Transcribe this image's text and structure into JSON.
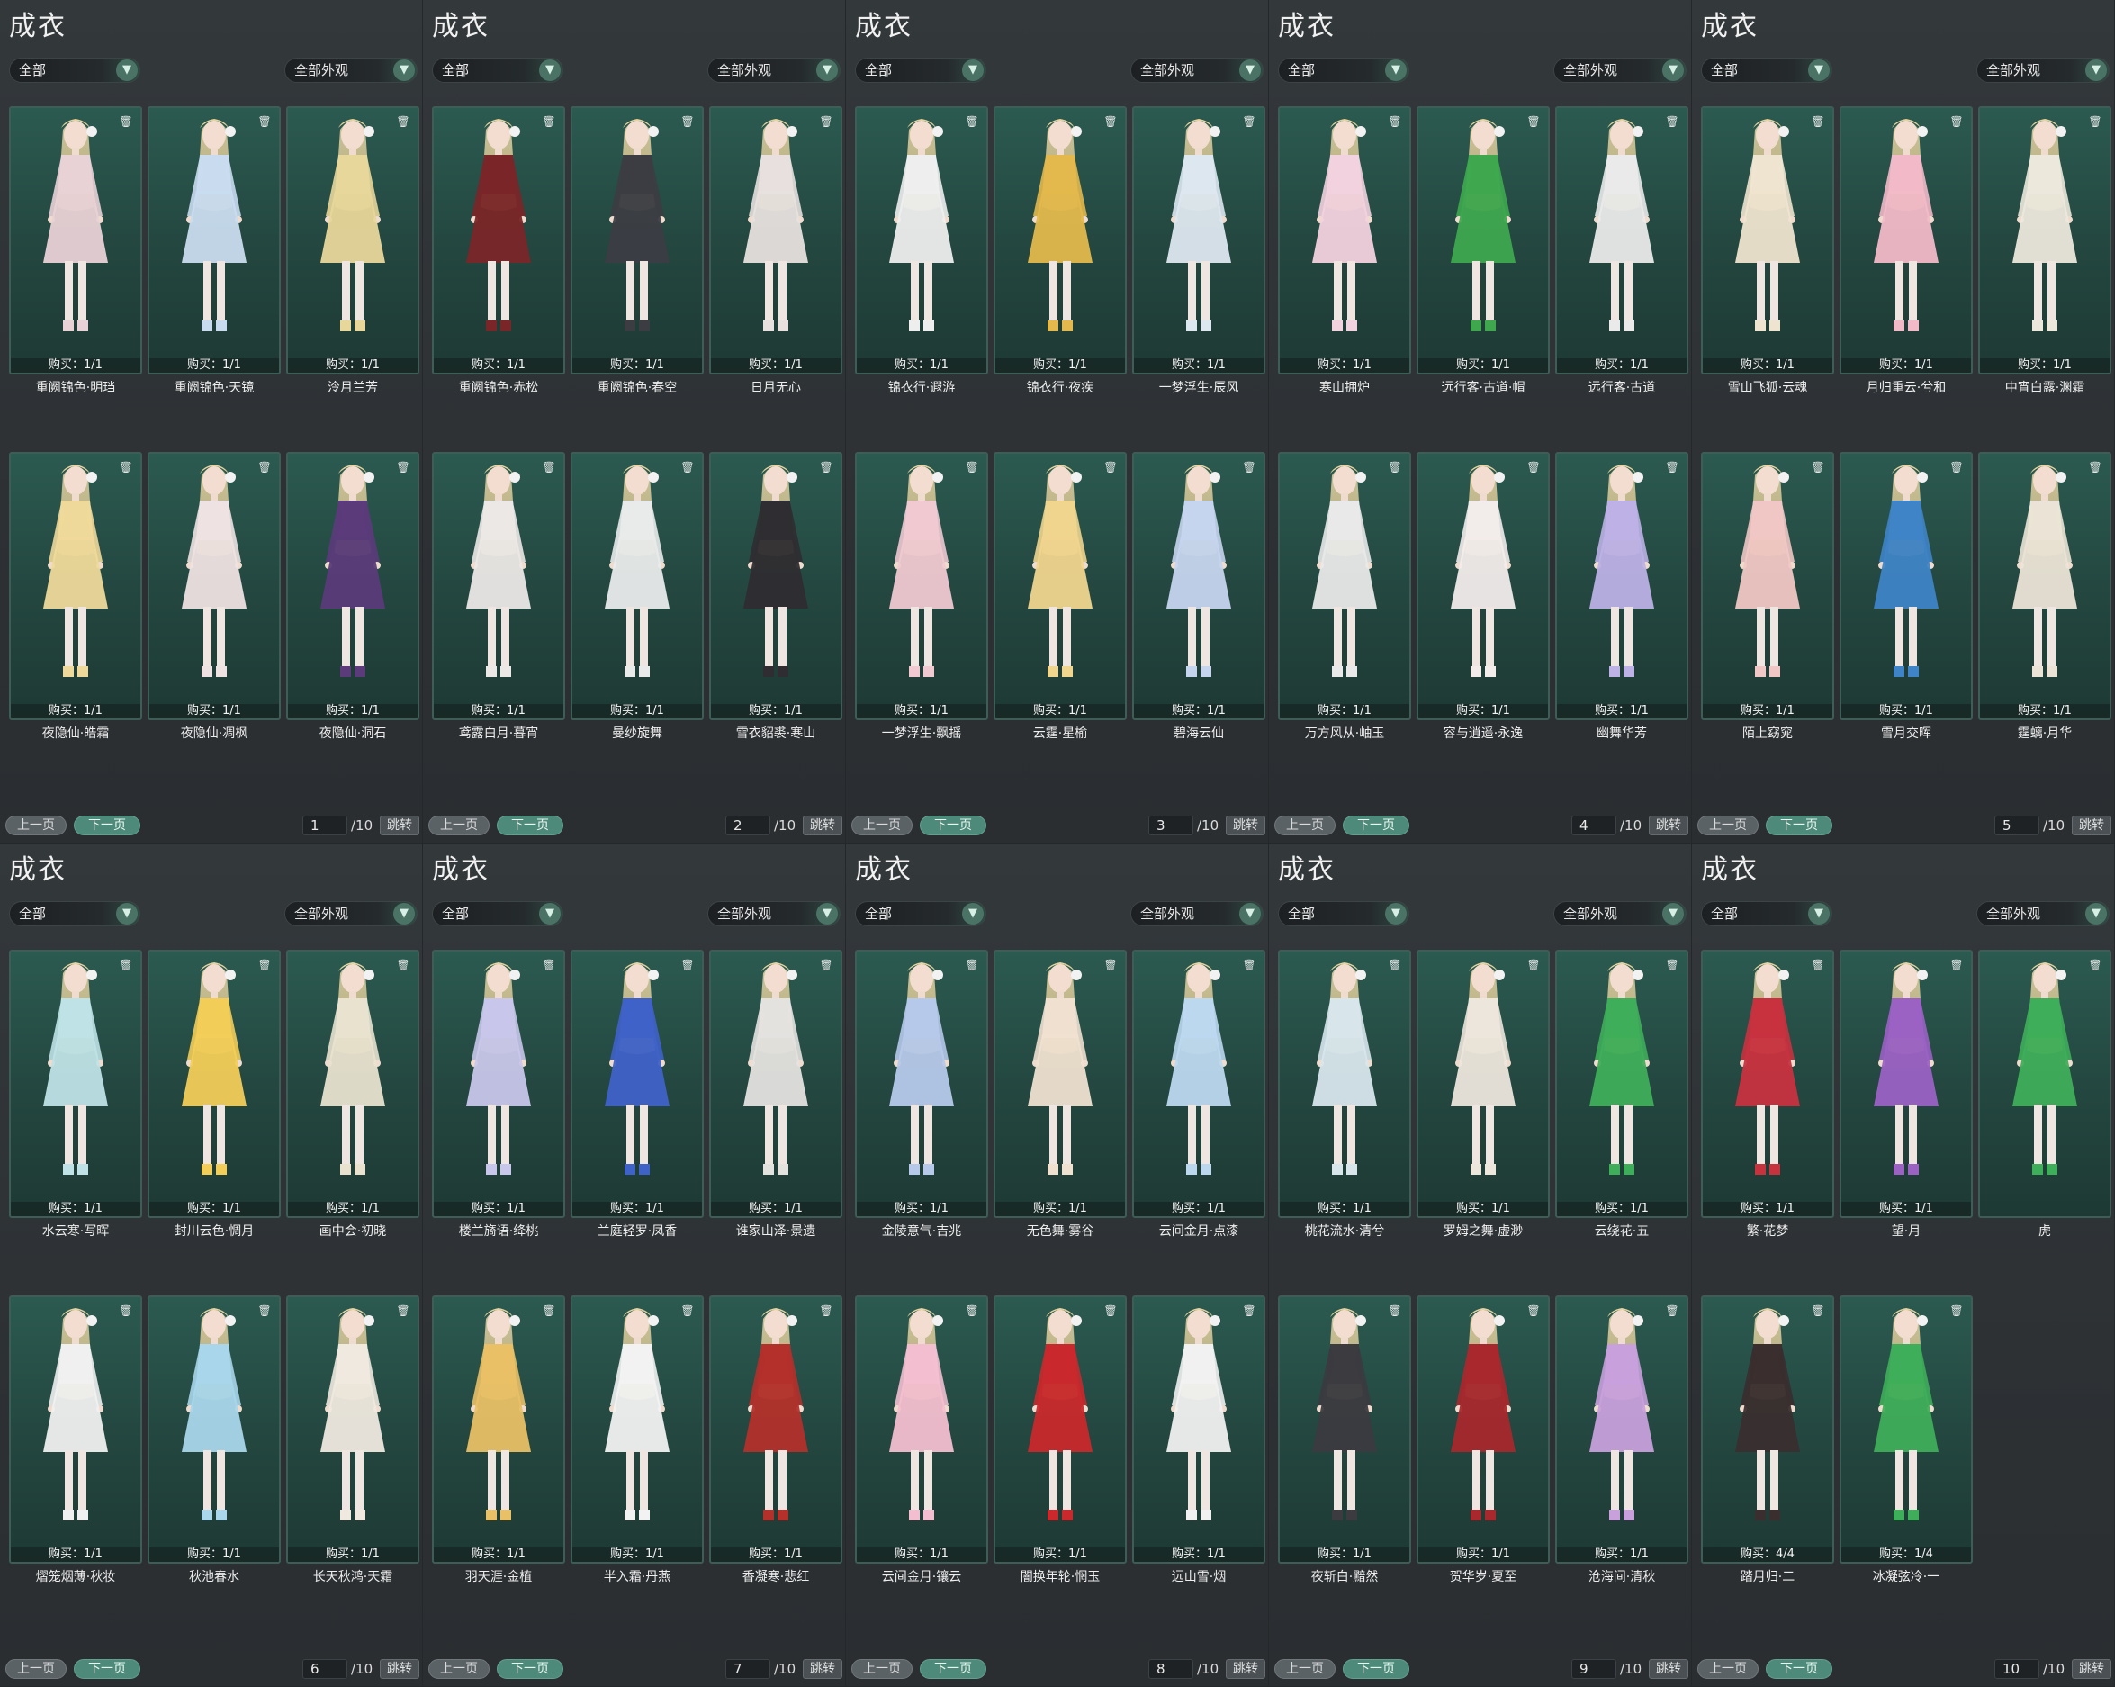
{
  "title": "成衣",
  "filter_all": "全部",
  "filter_appearance": "全部外观",
  "delete_icon": "trash-icon",
  "dropdown_icon": "chevron-down-icon",
  "pager": {
    "prev": "上一页",
    "next": "下一页",
    "jump": "跳转",
    "total": "/10"
  },
  "colors": {
    "accent": "#4d8a79",
    "card_bg": "#23463f",
    "panel_bg": "#2d3134"
  },
  "pages": [
    {
      "page": "1",
      "items": [
        {
          "name": "重阙锦色·明珰",
          "buy": "购买：1/1",
          "color": "#e9d2d6"
        },
        {
          "name": "重阙锦色·天镜",
          "buy": "购买：1/1",
          "color": "#c9dcef"
        },
        {
          "name": "泠月兰芳",
          "buy": "购买：1/1",
          "color": "#e8d79a"
        },
        {
          "name": "夜隐仙·皓霜",
          "buy": "购买：1/1",
          "color": "#efd99a"
        },
        {
          "name": "夜隐仙·凋枫",
          "buy": "购买：1/1",
          "color": "#eee2e2"
        },
        {
          "name": "夜隐仙·洞石",
          "buy": "购买：1/1",
          "color": "#5b3b7a"
        }
      ]
    },
    {
      "page": "2",
      "items": [
        {
          "name": "重阙锦色·赤松",
          "buy": "购买：1/1",
          "color": "#7a2628"
        },
        {
          "name": "重阙锦色·春空",
          "buy": "购买：1/1",
          "color": "#3c3d43"
        },
        {
          "name": "日月无心",
          "buy": "购买：1/1",
          "color": "#e7e0de"
        },
        {
          "name": "鸢露白月·暮宵",
          "buy": "购买：1/1",
          "color": "#ece8e6"
        },
        {
          "name": "曼纱旋舞",
          "buy": "购买：1/1",
          "color": "#e9ebeb"
        },
        {
          "name": "雪衣貂裘·寒山",
          "buy": "购买：1/1",
          "color": "#2f2d31"
        }
      ]
    },
    {
      "page": "3",
      "items": [
        {
          "name": "锦衣行·遐游",
          "buy": "购买：1/1",
          "color": "#eeeeee"
        },
        {
          "name": "锦衣行·夜疾",
          "buy": "购买：1/1",
          "color": "#e3b84c"
        },
        {
          "name": "一梦浮生·辰风",
          "buy": "购买：1/1",
          "color": "#dde7ef"
        },
        {
          "name": "一梦浮生·飘摇",
          "buy": "购买：1/1",
          "color": "#f0c9d1"
        },
        {
          "name": "云霆·星榆",
          "buy": "购买：1/1",
          "color": "#f0d58e"
        },
        {
          "name": "碧海云仙",
          "buy": "购买：1/1",
          "color": "#c6d5ee"
        }
      ]
    },
    {
      "page": "4",
      "items": [
        {
          "name": "寒山拥炉",
          "buy": "购买：1/1",
          "color": "#f2d2de"
        },
        {
          "name": "远行客·古道·帽",
          "buy": "购买：1/1",
          "color": "#3fa84f"
        },
        {
          "name": "远行客·古道",
          "buy": "购买：1/1",
          "color": "#eaeaea"
        },
        {
          "name": "万方风从·岫玉",
          "buy": "购买：1/1",
          "color": "#e9e9e9"
        },
        {
          "name": "容与逍遥·永逸",
          "buy": "购买：1/1",
          "color": "#f2eceb"
        },
        {
          "name": "幽舞华芳",
          "buy": "购买：1/1",
          "color": "#bdb1e6"
        }
      ]
    },
    {
      "page": "5",
      "items": [
        {
          "name": "雪山飞狐·云魂",
          "buy": "购买：1/1",
          "color": "#efe4cf"
        },
        {
          "name": "月归重云·兮和",
          "buy": "购买：1/1",
          "color": "#f2b9c8"
        },
        {
          "name": "中宵白露·渊霜",
          "buy": "购买：1/1",
          "color": "#ece8dc"
        },
        {
          "name": "陌上窈窕",
          "buy": "购买：1/1",
          "color": "#f0c7c4"
        },
        {
          "name": "雪月交晖",
          "buy": "购买：1/1",
          "color": "#3f84c6"
        },
        {
          "name": "霆螭·月华",
          "buy": "购买：1/1",
          "color": "#ebe4d6"
        }
      ]
    },
    {
      "page": "6",
      "items": [
        {
          "name": "水云寒·写晖",
          "buy": "购买：1/1",
          "color": "#bfe2e6"
        },
        {
          "name": "封川云色·惆月",
          "buy": "购买：1/1",
          "color": "#f2cd58"
        },
        {
          "name": "画中会·初晓",
          "buy": "购买：1/1",
          "color": "#e8e2cf"
        },
        {
          "name": "熠笼烟薄·秋妆",
          "buy": "购买：1/1",
          "color": "#f0f0f0"
        },
        {
          "name": "秋池春水",
          "buy": "购买：1/1",
          "color": "#a9d6ea"
        },
        {
          "name": "长天秋鸿·天霜",
          "buy": "购买：1/1",
          "color": "#efe9df"
        }
      ]
    },
    {
      "page": "7",
      "items": [
        {
          "name": "楼兰旖语·绛桃",
          "buy": "购买：1/1",
          "color": "#c8c6ea"
        },
        {
          "name": "兰庭轻罗·凤香",
          "buy": "购买：1/1",
          "color": "#3f62c8"
        },
        {
          "name": "谁家山泽·景遗",
          "buy": "购买：1/1",
          "color": "#e4e2df"
        },
        {
          "name": "羽天涯·金植",
          "buy": "购买：1/1",
          "color": "#e9c066"
        },
        {
          "name": "半入霜·丹燕",
          "buy": "购买：1/1",
          "color": "#f2f2f2"
        },
        {
          "name": "香凝寒·悲红",
          "buy": "购买：1/1",
          "color": "#b3302b"
        }
      ]
    },
    {
      "page": "8",
      "items": [
        {
          "name": "金陵意气·吉兆",
          "buy": "购买：1/1",
          "color": "#b6c9ea"
        },
        {
          "name": "无色舞·雾谷",
          "buy": "购买：1/1",
          "color": "#efe0d0"
        },
        {
          "name": "云间金月·点漆",
          "buy": "购买：1/1",
          "color": "#bcd8ef"
        },
        {
          "name": "云间金月·镶云",
          "buy": "购买：1/1",
          "color": "#f3bfd0"
        },
        {
          "name": "闇换年轮·惘玉",
          "buy": "购买：1/1",
          "color": "#c9292c"
        },
        {
          "name": "远山雪·烟",
          "buy": "购买：1/1",
          "color": "#f1f1f1"
        }
      ]
    },
    {
      "page": "9",
      "items": [
        {
          "name": "桃花流水·清兮",
          "buy": "购买：1/1",
          "color": "#d8e6ec"
        },
        {
          "name": "罗姆之舞·虚渺",
          "buy": "购买：1/1",
          "color": "#ede6dc"
        },
        {
          "name": "云绕花·五",
          "buy": "购买：1/1",
          "color": "#3fae5a"
        },
        {
          "name": "夜斩白·黯然",
          "buy": "购买：1/1",
          "color": "#3b3b40"
        },
        {
          "name": "贺华岁·夏至",
          "buy": "购买：1/1",
          "color": "#a8282d"
        },
        {
          "name": "沧海间·清秋",
          "buy": "购买：1/1",
          "color": "#c8a0dc"
        }
      ]
    },
    {
      "page": "10",
      "items": [
        {
          "name": "繁·花梦",
          "buy": "购买：1/1",
          "color": "#c8323f"
        },
        {
          "name": "望·月",
          "buy": "购买：1/1",
          "color": "#9b62c4"
        },
        {
          "name": "虎",
          "buy": "",
          "color": "#3fae5a"
        },
        {
          "name": "踏月归·二",
          "buy": "购买：4/4",
          "color": "#3a2e2f"
        },
        {
          "name": "冰凝弦冷·一",
          "buy": "购买：1/4",
          "color": "#3fae5a"
        }
      ]
    }
  ]
}
